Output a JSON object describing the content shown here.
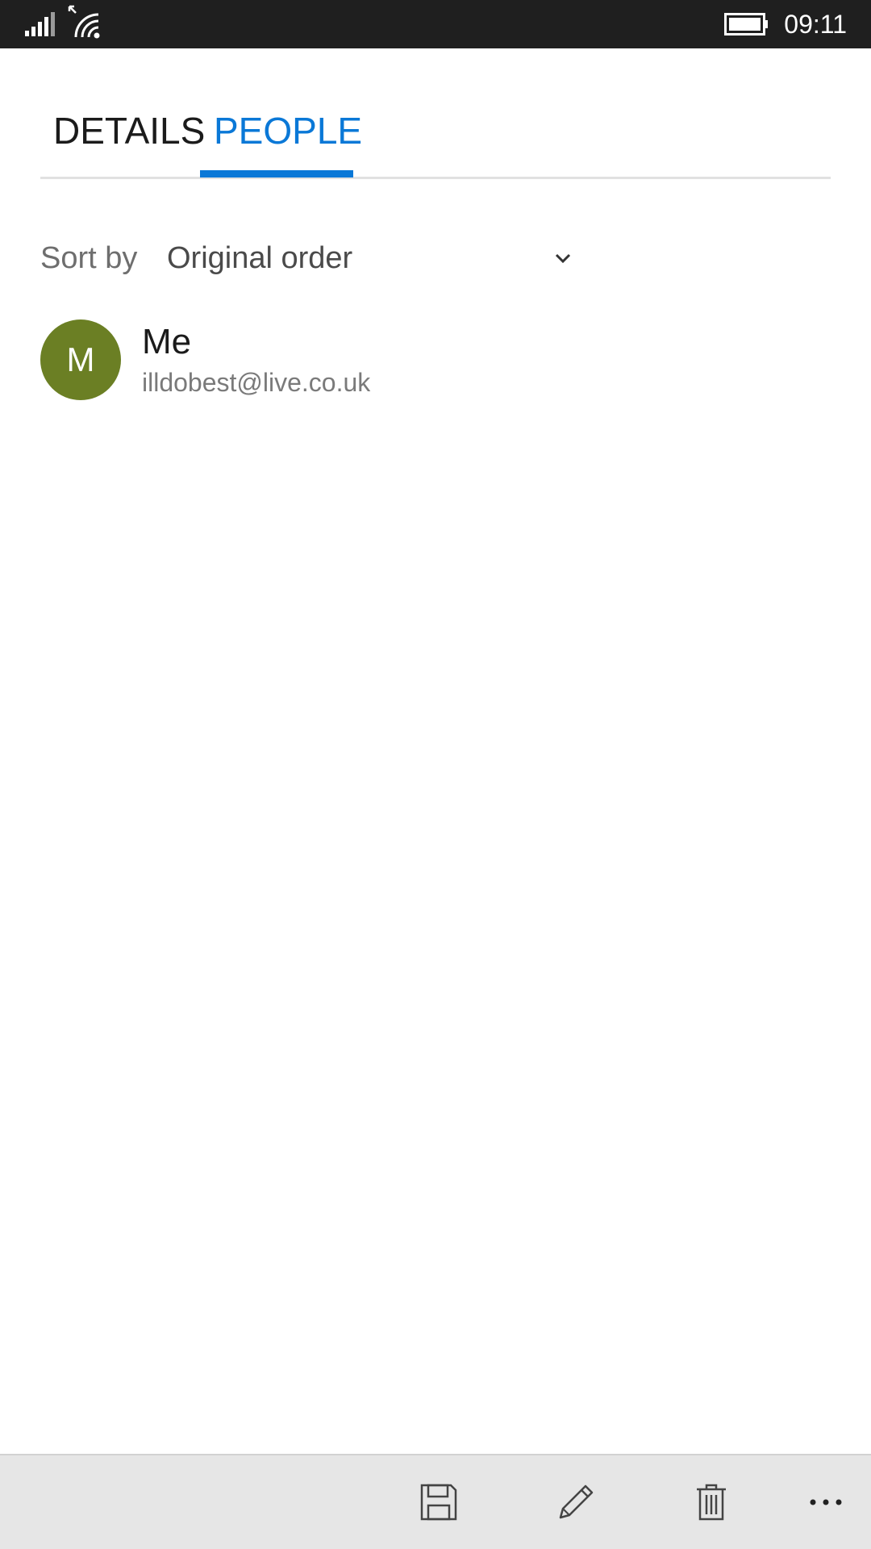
{
  "status_bar": {
    "time": "09:11",
    "icons": [
      "signal-icon",
      "wifi-icon",
      "battery-icon"
    ]
  },
  "tabs": [
    {
      "label": "DETAILS",
      "selected": false
    },
    {
      "label": "PEOPLE",
      "selected": true
    }
  ],
  "sort": {
    "label": "Sort by",
    "value": "Original order"
  },
  "people": [
    {
      "initial": "M",
      "name": "Me",
      "email": "illdobest@live.co.uk",
      "avatar_color": "#6b7f24"
    }
  ],
  "app_bar": {
    "buttons": [
      "save-icon",
      "edit-icon",
      "delete-icon",
      "more-icon"
    ]
  },
  "colors": {
    "accent": "#0a78d7",
    "status_bar": "#1f1f1f",
    "app_bar": "#e6e6e6"
  }
}
